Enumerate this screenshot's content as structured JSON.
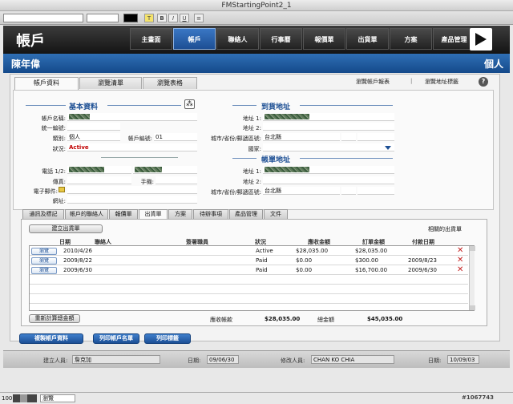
{
  "window": {
    "title": "FMStartingPoint2_1"
  },
  "nav": {
    "logo": "帳戶",
    "items": [
      "主畫面",
      "帳戶",
      "聯絡人",
      "行事曆",
      "報價單",
      "出貨單",
      "方案",
      "產品管理"
    ],
    "active_index": 1
  },
  "header": {
    "account_name": "陳年偉",
    "account_type": "個人"
  },
  "tabs": [
    "帳戶資料",
    "瀏覽清單",
    "瀏覽表格"
  ],
  "links": {
    "view_report": "瀏覽帳戶報表",
    "view_map": "瀏覽地址標籤"
  },
  "basic": {
    "title": "基本資料",
    "labels": {
      "name": "帳戶名稱:",
      "tax_id": "統一編號:",
      "category": "類別:",
      "account_no": "帳戶編號:",
      "status": "狀況:",
      "phone": "電話 1/2:",
      "fax": "傳真:",
      "mobile": "手機:",
      "email": "電子郵件:",
      "website": "網址:"
    },
    "values": {
      "category": "個人",
      "account_no": "01",
      "status": "Active"
    }
  },
  "shipping": {
    "title": "到貨地址",
    "labels": {
      "addr1": "地址 1:",
      "addr2": "地址 2:",
      "city": "城市/省份/郵遞區號:",
      "country": "國家:"
    },
    "values": {
      "city": "台北縣"
    }
  },
  "billing": {
    "title": "帳單地址",
    "labels": {
      "addr1": "地址 1:",
      "addr2": "地址 2:",
      "city": "城市/省份/郵遞區號:"
    },
    "values": {
      "city": "台北縣"
    }
  },
  "subtabs": [
    "通訊及標記",
    "帳戶的聯絡人",
    "報價單",
    "出貨單",
    "方案",
    "待辦事項",
    "產品管理",
    "文件"
  ],
  "subtab_active": 3,
  "portal": {
    "create_button": "建立出貨單",
    "related_label": "相關的出貨單",
    "columns": [
      "日期",
      "聯絡人",
      "簽署職員",
      "狀況",
      "應收金額",
      "訂單金額",
      "付款日期"
    ],
    "rows": [
      {
        "view": "瀏覽",
        "date": "2010/4/26",
        "status": "Active",
        "receivable": "$28,035.00",
        "order": "$28,035.00",
        "paid": ""
      },
      {
        "view": "瀏覽",
        "date": "2009/8/22",
        "status": "Paid",
        "receivable": "$0.00",
        "order": "$300.00",
        "paid": "2009/8/23"
      },
      {
        "view": "瀏覽",
        "date": "2009/6/30",
        "status": "Paid",
        "receivable": "$0.00",
        "order": "$16,700.00",
        "paid": "2009/6/30"
      }
    ],
    "recalc_button": "重新計算總金額",
    "receivable_label": "應收帳款",
    "receivable_total": "$28,035.00",
    "total_label": "總金額",
    "total_value": "$45,035.00"
  },
  "buttons": {
    "copy": "複製帳戶資料",
    "print_list": "列印帳戶名單",
    "print_label": "列印標籤"
  },
  "footer": {
    "created_by_label": "建立人員:",
    "created_by": "詹克加",
    "created_date_label": "日期:",
    "created_date": "09/06/30",
    "modified_by_label": "修改人員:",
    "modified_by": "CHAN KO CHIA",
    "modified_date_label": "日期:",
    "modified_date": "10/09/03"
  },
  "status": {
    "zoom": "100",
    "mode": "瀏覽",
    "watermark": "#1067743"
  },
  "colors": {
    "accent": "#1d4f94",
    "header_bg": "#14498a",
    "active_red": "#c00000"
  }
}
